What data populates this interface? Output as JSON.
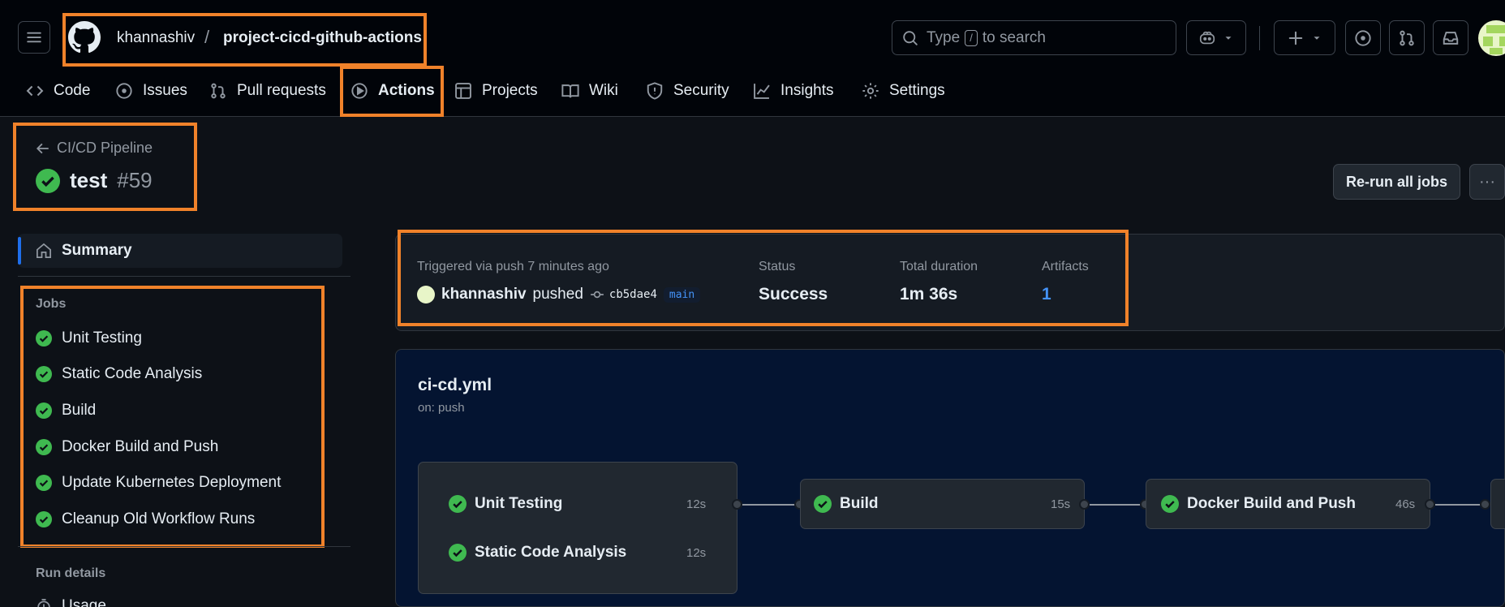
{
  "header": {
    "owner": "khannashiv",
    "separator": "/",
    "repo": "project-cicd-github-actions",
    "search_prefix": "Type",
    "search_key": "/",
    "search_suffix": "to search"
  },
  "tabs": [
    {
      "label": "Code",
      "icon": "code-icon"
    },
    {
      "label": "Issues",
      "icon": "issue-icon"
    },
    {
      "label": "Pull requests",
      "icon": "pull-request-icon"
    },
    {
      "label": "Actions",
      "icon": "play-icon",
      "active": true
    },
    {
      "label": "Projects",
      "icon": "table-icon"
    },
    {
      "label": "Wiki",
      "icon": "book-icon"
    },
    {
      "label": "Security",
      "icon": "shield-icon"
    },
    {
      "label": "Insights",
      "icon": "graph-icon"
    },
    {
      "label": "Settings",
      "icon": "gear-icon"
    }
  ],
  "run": {
    "back_label": "CI/CD Pipeline",
    "name": "test",
    "number": "#59",
    "rerun_label": "Re-run all jobs",
    "more_label": "···"
  },
  "sidebar": {
    "summary_label": "Summary",
    "jobs_heading": "Jobs",
    "jobs": [
      "Unit Testing",
      "Static Code Analysis",
      "Build",
      "Docker Build and Push",
      "Update Kubernetes Deployment",
      "Cleanup Old Workflow Runs"
    ],
    "run_details_heading": "Run details",
    "usage_label": "Usage"
  },
  "summary": {
    "trigger_text": "Triggered via push 7 minutes ago",
    "actor": "khannashiv",
    "action": "pushed",
    "commit": "cb5dae4",
    "branch": "main",
    "status_label": "Status",
    "status_value": "Success",
    "duration_label": "Total duration",
    "duration_value": "1m 36s",
    "artifacts_label": "Artifacts",
    "artifacts_value": "1"
  },
  "workflow": {
    "file": "ci-cd.yml",
    "trigger": "on: push",
    "nodes": [
      {
        "name": "Unit Testing",
        "duration": "12s"
      },
      {
        "name": "Static Code Analysis",
        "duration": "12s"
      },
      {
        "name": "Build",
        "duration": "15s"
      },
      {
        "name": "Docker Build and Push",
        "duration": "46s"
      }
    ]
  },
  "colors": {
    "success": "#3fb950",
    "highlight": "#f0822a",
    "accent": "#1f6feb"
  }
}
